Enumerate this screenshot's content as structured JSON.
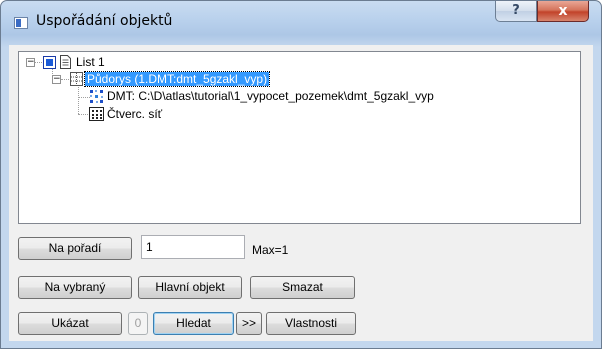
{
  "window": {
    "title": "Uspořádání objektů",
    "help_label": "?",
    "close_label": "x"
  },
  "tree": {
    "items": [
      {
        "label": "List 1",
        "expander": "−",
        "icon": "page-icon"
      },
      {
        "label": "Půdorys (1.DMT:dmt_5gzakl_vyp)",
        "expander": "−",
        "icon": "grid-frame-icon",
        "selected": true
      },
      {
        "label": "DMT: C:\\D\\atlas\\tutorial\\1_vypocet_pozemek\\dmt_5gzakl_vyp",
        "icon": "point-cloud-icon"
      },
      {
        "label": "Čtverc. síť",
        "icon": "square-grid-icon"
      }
    ]
  },
  "controls": {
    "na_poradi_label": "Na pořadí",
    "order_value": "1",
    "max_label": "Max=1",
    "na_vybrany_label": "Na vybraný",
    "hlavni_objekt_label": "Hlavní objekt",
    "smazat_label": "Smazat",
    "ukazat_label": "Ukázat",
    "counter_label": "0",
    "hledat_label": "Hledat",
    "next_label": ">>",
    "vlastnosti_label": "Vlastnosti"
  }
}
